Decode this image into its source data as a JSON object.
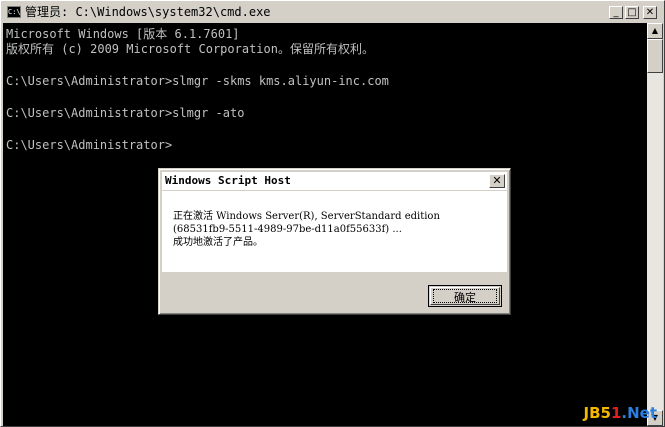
{
  "window": {
    "title": "管理员: C:\\Windows\\system32\\cmd.exe",
    "app_icon": "C:\\",
    "buttons": {
      "minimize": "_",
      "maximize": "□",
      "close": "✕"
    }
  },
  "console": {
    "lines": [
      "Microsoft Windows [版本 6.1.7601]",
      "版权所有 (c) 2009 Microsoft Corporation。保留所有权利。",
      "",
      "C:\\Users\\Administrator>slmgr -skms kms.aliyun-inc.com",
      "",
      "C:\\Users\\Administrator>slmgr -ato",
      "",
      "C:\\Users\\Administrator>"
    ]
  },
  "scrollbar": {
    "up": "▲",
    "down": "▼"
  },
  "dialog": {
    "title": "Windows Script Host",
    "close": "✕",
    "message": [
      "正在激活 Windows Server(R), ServerStandard edition",
      "(68531fb9-5511-4989-97be-d11a0f55633f) ...",
      "成功地激活了产品。"
    ],
    "ok_label": "确定"
  },
  "watermark": {
    "part1": "JB5",
    "part2": "1",
    "part3": ".Net"
  }
}
